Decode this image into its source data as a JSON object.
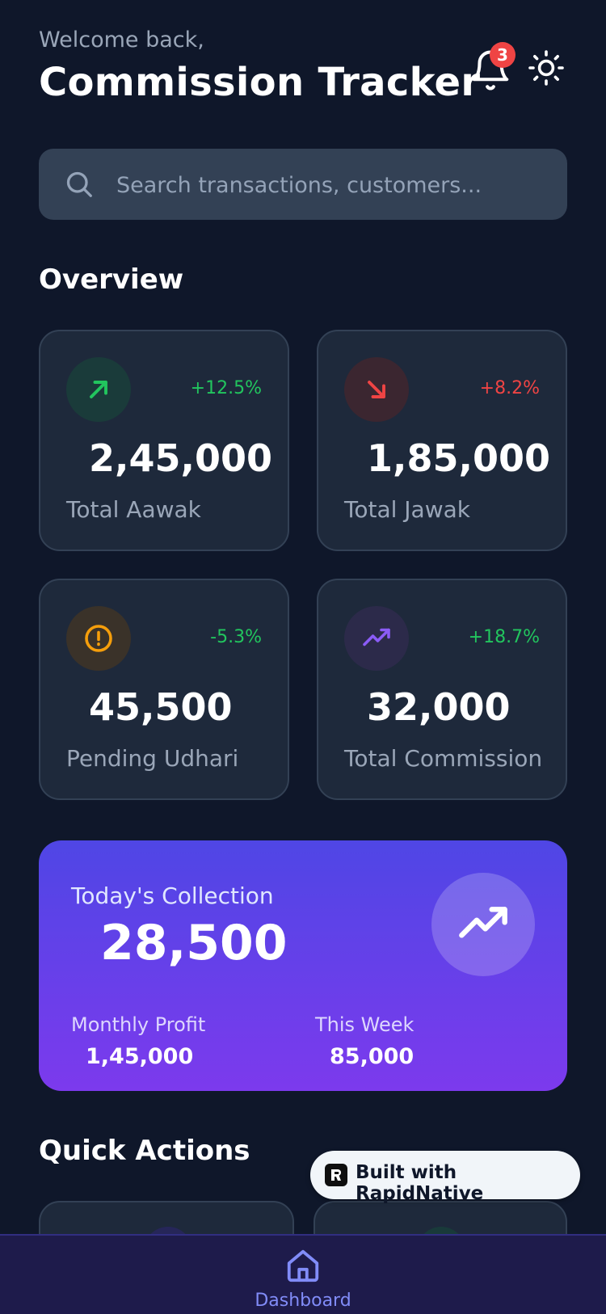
{
  "header": {
    "welcome": "Welcome back,",
    "title": "Commission Tracker",
    "notification_count": "3",
    "bell_icon": "bell-icon",
    "theme_icon": "sun-icon"
  },
  "search": {
    "placeholder": "Search transactions, customers...",
    "value": "",
    "icon": "search-icon"
  },
  "overview": {
    "title": "Overview",
    "cards": [
      {
        "label": "Total Aawak",
        "value": "2,45,000",
        "change": "+12.5%",
        "change_color": "#22c55e",
        "icon": "arrow-up-right-icon",
        "icon_color": "#22c55e",
        "icon_bg": "#1a3b3a"
      },
      {
        "label": "Total Jawak",
        "value": "1,85,000",
        "change": "+8.2%",
        "change_color": "#ef4444",
        "icon": "arrow-down-right-icon",
        "icon_color": "#ef4444",
        "icon_bg": "#3b2630"
      },
      {
        "label": "Pending Udhari",
        "value": "45,500",
        "change": "-5.3%",
        "change_color": "#22c55e",
        "icon": "alert-circle-icon",
        "icon_color": "#f59e0b",
        "icon_bg": "#3a3229"
      },
      {
        "label": "Total Commission",
        "value": "32,000",
        "change": "+18.7%",
        "change_color": "#22c55e",
        "icon": "trending-up-icon",
        "icon_color": "#8b5cf6",
        "icon_bg": "#2c2a4a"
      }
    ]
  },
  "collection": {
    "label": "Today's Collection",
    "value": "28,500",
    "icon": "trending-up-icon",
    "monthly_profit_label": "Monthly Profit",
    "monthly_profit_value": "1,45,000",
    "this_week_label": "This Week",
    "this_week_value": "85,000"
  },
  "quick_actions": {
    "title": "Quick Actions"
  },
  "built_with": {
    "text": "Built with RapidNative",
    "icon": "rapidnative-logo-icon"
  },
  "bottom_nav": {
    "items": [
      {
        "label": "Dashboard",
        "icon": "home-icon",
        "active": true
      }
    ],
    "active_color": "#818cf8"
  }
}
